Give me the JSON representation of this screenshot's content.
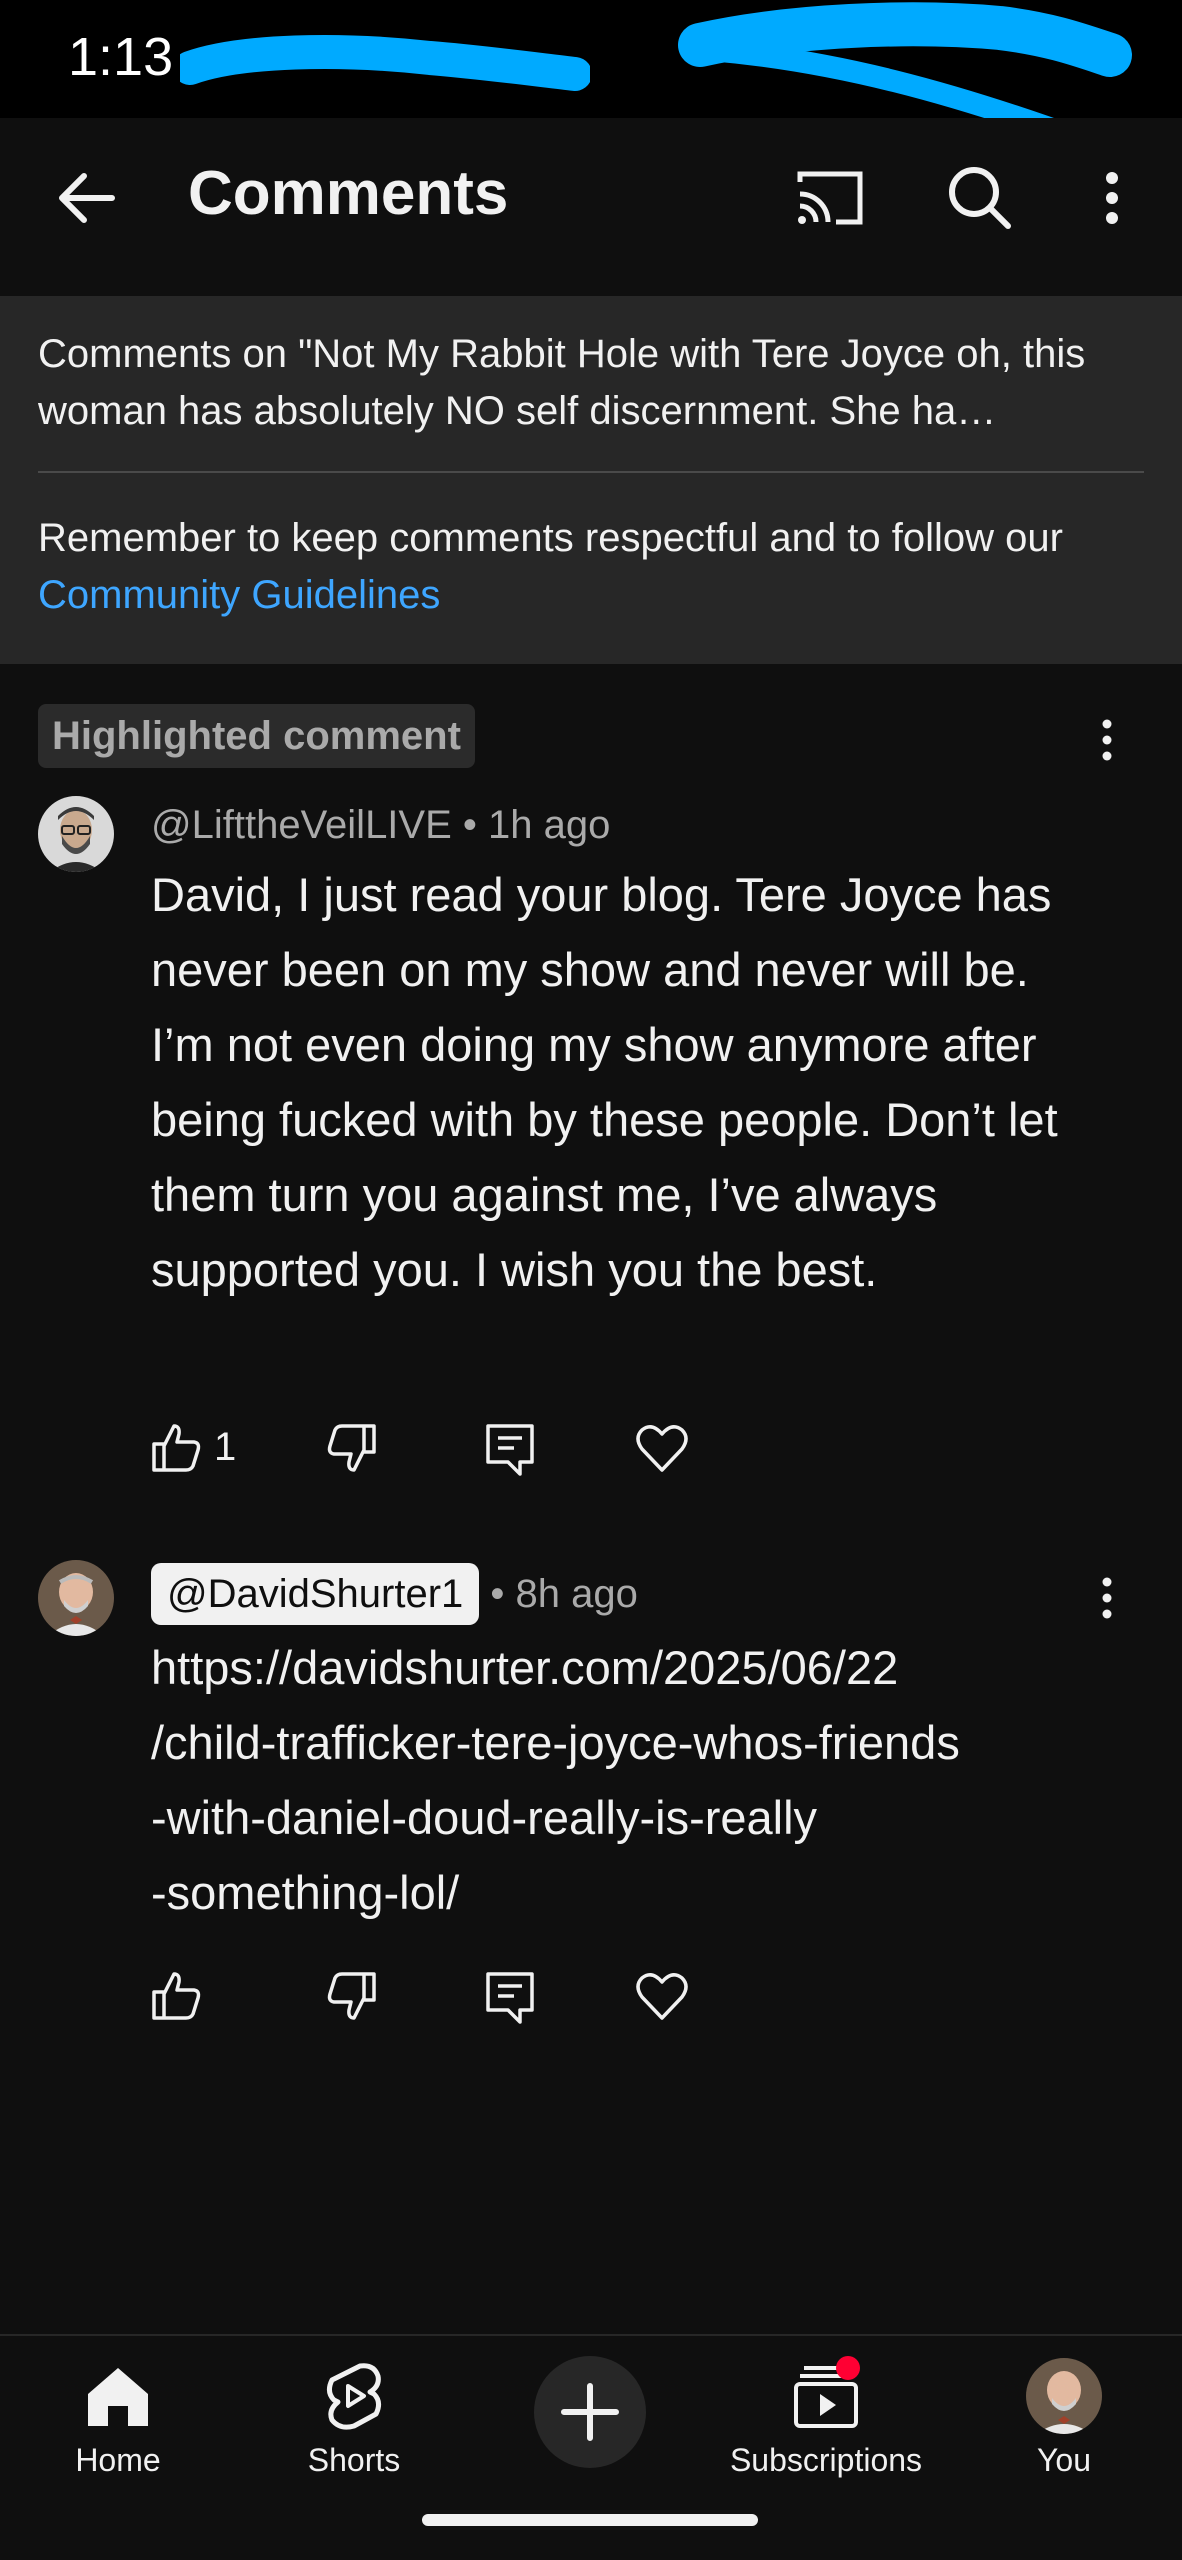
{
  "status_bar": {
    "time": "1:13"
  },
  "app_bar": {
    "title": "Comments"
  },
  "header": {
    "video_context": "Comments on \"Not My Rabbit Hole with Tere Joyce  oh, this woman has absolutely NO self discernment. She ha…",
    "guidelines_prefix": "Remember to keep comments respectful and to follow our ",
    "guidelines_link": "Community Guidelines"
  },
  "comments": [
    {
      "badge": "Highlighted comment",
      "author": "@LifttheVeilLIVE",
      "time": " • 1h ago",
      "body": "David, I just read your blog. Tere Joyce has never been on my show and never will be. I’m not even doing my show anymore after being fucked with by these people. Don’t let them turn you against me, I’ve always supported you. I wish you the best.",
      "likes": "1"
    },
    {
      "author": "@DavidShurter1",
      "time": " • 8h ago",
      "body_lines": [
        "https://davidshurter.com/2025/06/22",
        "/child-trafficker-tere-joyce-whos-friends",
        "-with-daniel-doud-really-is-really",
        "-something-lol/"
      ]
    }
  ],
  "bottom_nav": {
    "items": [
      {
        "label": "Home",
        "icon": "home-icon"
      },
      {
        "label": "Shorts",
        "icon": "shorts-icon"
      },
      {
        "label": "Create",
        "icon": "plus-icon"
      },
      {
        "label": "Subscriptions",
        "icon": "subscriptions-icon"
      },
      {
        "label": "You",
        "icon": "avatar"
      }
    ]
  },
  "colors": {
    "background": "#0f0f0f",
    "panel": "#272727",
    "link": "#3ea6ff",
    "notification": "#ff0033"
  }
}
